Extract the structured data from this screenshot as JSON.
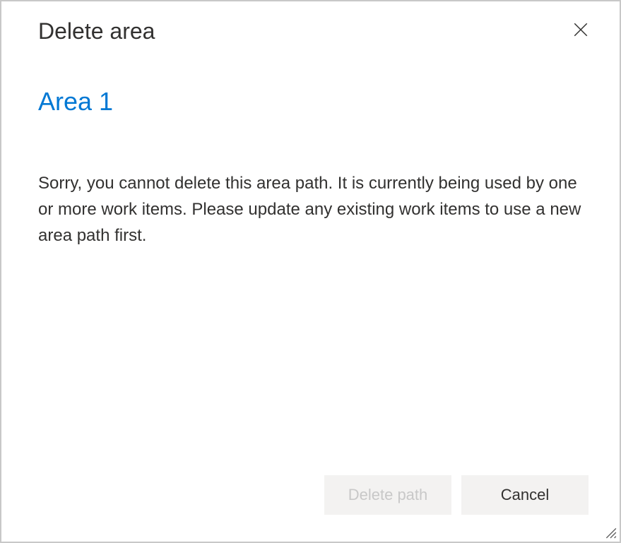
{
  "dialog": {
    "title": "Delete area",
    "area_name": "Area 1",
    "message": "Sorry, you cannot delete this area path. It is currently being used by one or more work items. Please update any existing work items to use a new area path first.",
    "actions": {
      "delete_label": "Delete path",
      "delete_disabled": true,
      "cancel_label": "Cancel"
    }
  }
}
